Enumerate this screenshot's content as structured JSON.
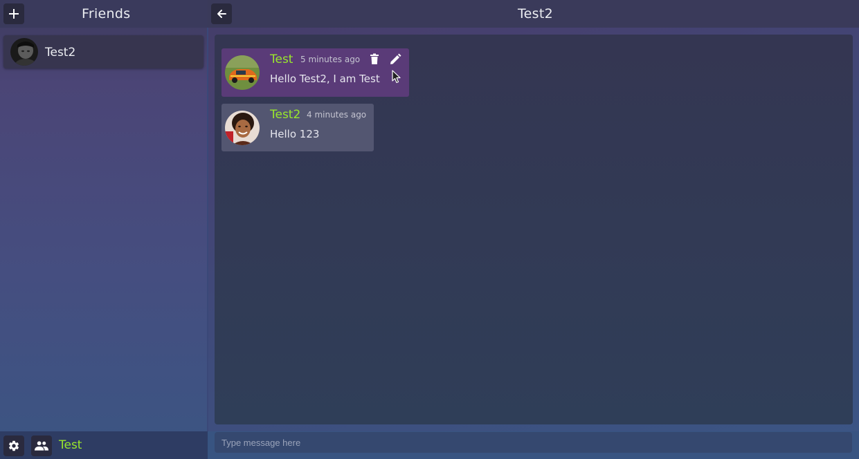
{
  "sidebar": {
    "title": "Friends",
    "add_icon": "plus-icon",
    "friends": [
      {
        "name": "Test2",
        "avatar": "avatar-dark-portrait"
      }
    ]
  },
  "chat": {
    "title": "Test2",
    "back_icon": "arrow-left-icon",
    "messages": [
      {
        "author": "Test",
        "time": "5 minutes ago",
        "text": "Hello Test2, I am Test",
        "own": true,
        "avatar": "avatar-orange-car",
        "actions": [
          "trash-icon",
          "pencil-icon"
        ]
      },
      {
        "author": "Test2",
        "time": "4 minutes ago",
        "text": "Hello 123",
        "own": false,
        "avatar": "avatar-woman-portrait"
      }
    ]
  },
  "composer": {
    "placeholder": "Type message here",
    "value": ""
  },
  "footer": {
    "settings_icon": "gear-icon",
    "friends_icon": "people-icon",
    "current_user": "Test"
  },
  "colors": {
    "accent_name": "#9ae82c",
    "own_message_bg": "#5a3b78",
    "other_message_bg": "#535671"
  }
}
